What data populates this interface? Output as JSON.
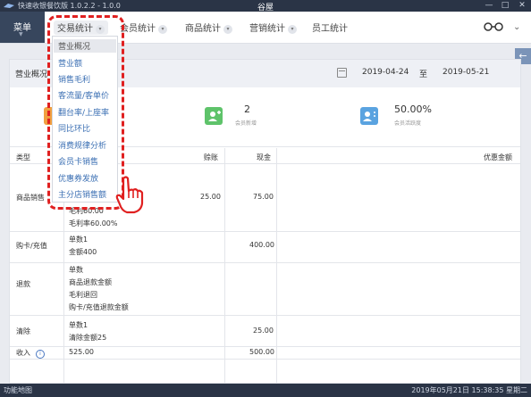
{
  "titlebar": {
    "app_title": "快速收银餐饮版 1.0.2.2 - 1.0.0",
    "center_title": "谷屋",
    "min": "—",
    "max": "□",
    "close": "✕"
  },
  "nav": {
    "menu_label": "菜单",
    "items": [
      "交易统计",
      "会员统计",
      "商品统计",
      "营销统计",
      "员工统计"
    ]
  },
  "dropdown": {
    "items": [
      "营业概况",
      "营业额",
      "销售毛利",
      "客流量/客单价",
      "翻台率/上座率",
      "同比环比",
      "消费规律分析",
      "会员卡销售",
      "优惠券发放",
      "主分店销售额"
    ]
  },
  "section": {
    "title": "营业概况",
    "date_from": "2019-04-24",
    "date_to_label": "至",
    "date_to": "2019-05-21"
  },
  "stats": [
    {
      "value": "2",
      "label": "会员新增",
      "color": "#5ec36a"
    },
    {
      "value": "50.00%",
      "label": "会员活跃度",
      "color": "#5aa3e0"
    }
  ],
  "table": {
    "headers": {
      "type": "类型",
      "credit": "赊账",
      "cash": "现金",
      "discount": "优惠金额"
    },
    "rows": [
      {
        "type": "商品销售",
        "details": [
          "毛利60.00",
          "毛利率60.00%"
        ],
        "credit": "25.00",
        "cash": "75.00"
      },
      {
        "type": "购卡/充值",
        "details": [
          "单数1",
          "金额400"
        ],
        "credit": "",
        "cash": "400.00"
      },
      {
        "type": "退款",
        "details": [
          "单数",
          "商品退款金额",
          "毛利退回",
          "购卡/充值退款金额"
        ],
        "credit": "",
        "cash": ""
      },
      {
        "type": "清除",
        "details": [
          "单数1",
          "清除金额25"
        ],
        "credit": "",
        "cash": "25.00"
      },
      {
        "type": "收入",
        "details": [
          "525.00"
        ],
        "credit": "",
        "cash": "500.00"
      }
    ]
  },
  "statusbar": {
    "left": "功能地图",
    "right": "2019年05月21日 15:38:35 星期二"
  },
  "colors": {
    "titlebar": "#2a3446",
    "menu": "#37465d",
    "annotation": "#e02020",
    "link": "#3b6fb3"
  }
}
